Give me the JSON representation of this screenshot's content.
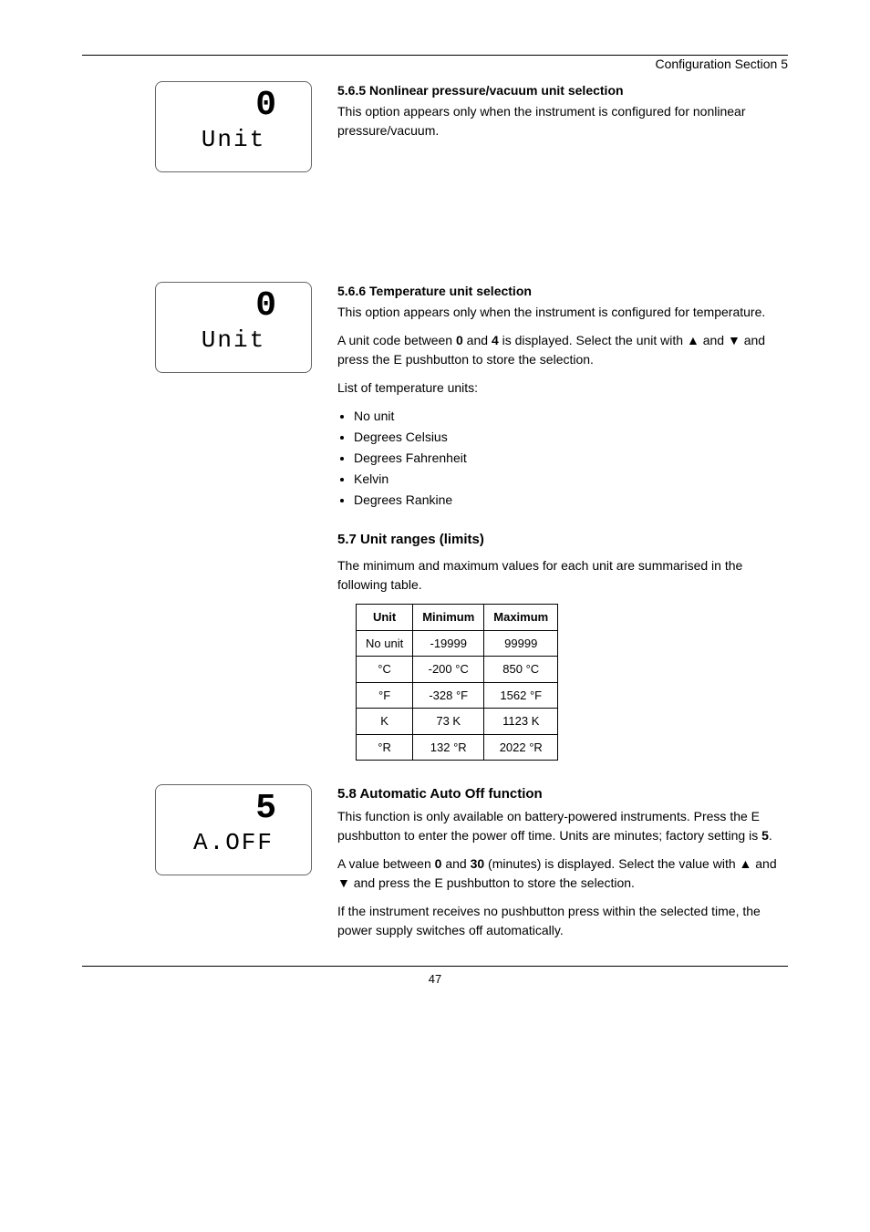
{
  "header": {
    "right": "Configuration Section 5"
  },
  "s1": {
    "lcd": {
      "row1": "0",
      "row2": "Unit"
    },
    "title": "5.6.5 Nonlinear pressure/vacuum unit selection",
    "body": "This option appears only when the instrument is configured for nonlinear pressure/vacuum."
  },
  "s2": {
    "lcd": {
      "row1": "0",
      "row2": "Unit"
    },
    "title": "5.6.6 Temperature unit selection",
    "body1": "This option appears only when the instrument is configured for temperature.",
    "body2a": "A unit code between ",
    "body2b": " and ",
    "body2c": " is displayed. Select the unit with ",
    "body2d": " and ",
    "body2e": " and press the E pushbutton to store the selection.",
    "code_lo": "0",
    "code_hi": "4",
    "arr_up": "▲",
    "arr_dn": "▼",
    "list_intro": "List of temperature units:",
    "units": [
      "No unit",
      "Degrees Celsius",
      "Degrees Fahrenheit",
      "Kelvin",
      "Degrees Rankine"
    ]
  },
  "limits": {
    "heading": "5.7 Unit ranges (limits)",
    "intro": "The minimum and maximum values for each unit are summarised in the following table.",
    "cols": [
      "Unit",
      "Minimum",
      "Maximum"
    ],
    "rows": [
      [
        "No unit",
        "-19999",
        "99999"
      ],
      [
        "°C",
        "-200 °C",
        "850 °C"
      ],
      [
        "°F",
        "-328 °F",
        "1562 °F"
      ],
      [
        "K",
        "73 K",
        "1123 K"
      ],
      [
        "°R",
        "132 °R",
        "2022 °R"
      ]
    ]
  },
  "s3": {
    "lcd": {
      "row1": "5",
      "row2": "A.OFF"
    },
    "title": "5.8 Automatic Auto Off function",
    "p1a": "This function is only available on battery-powered instruments. Press the E pushbutton to enter the power off time. Units are minutes; factory setting is ",
    "p1b": ".",
    "factory": "5",
    "p2a": "A value between ",
    "p2lo": "0",
    "p2b": " and ",
    "p2hi": "30",
    "p2c": " (minutes) is displayed. Select the value with ",
    "p2_up": "▲",
    "p2d": " and ",
    "p2_dn": "▼",
    "p2e": " and press the E pushbutton to store the selection.",
    "p3": "If the instrument receives no pushbutton press within the selected time, the power supply switches off automatically."
  },
  "pagenum": "47"
}
